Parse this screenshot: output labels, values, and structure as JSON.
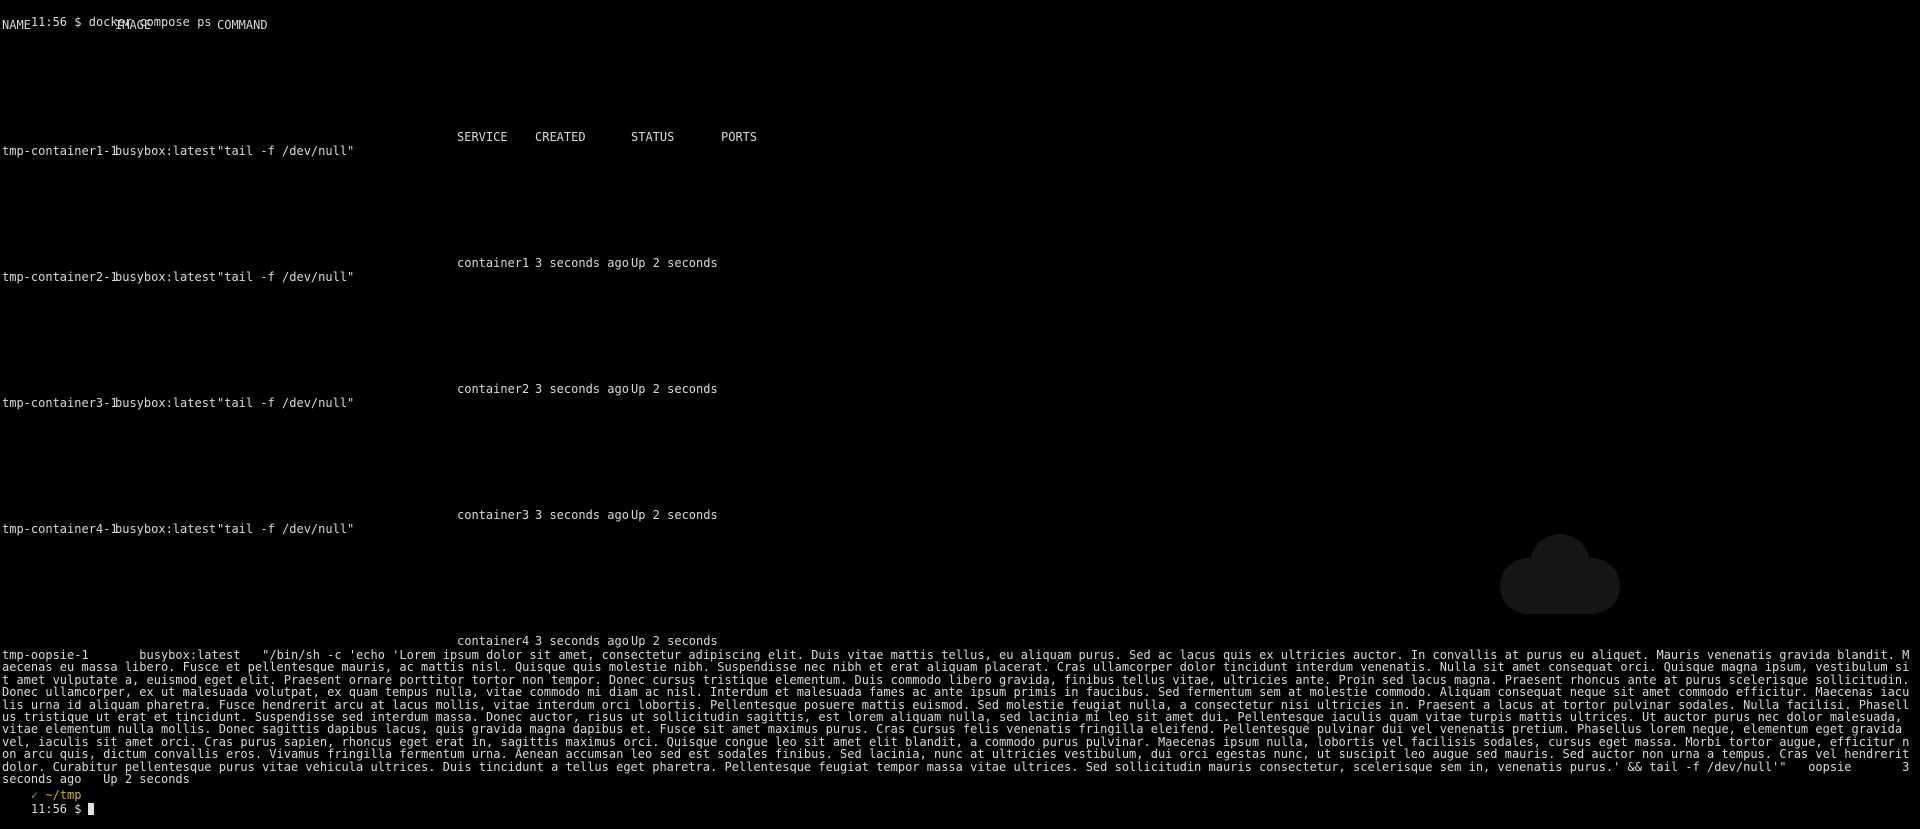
{
  "command": {
    "time": "11:56",
    "text": "$ docker compose ps"
  },
  "headers_row1": {
    "name": "NAME",
    "image": "IMAGE",
    "command": "COMMAND"
  },
  "headers_row2": {
    "service": "SERVICE",
    "created": "CREATED",
    "status": "STATUS",
    "ports": "PORTS"
  },
  "containers": [
    {
      "name": "tmp-container1-1",
      "image": "busybox:latest",
      "command": "\"tail -f /dev/null\"",
      "service": "container1",
      "created": "3 seconds ago",
      "status": "Up 2 seconds"
    },
    {
      "name": "tmp-container2-1",
      "image": "busybox:latest",
      "command": "\"tail -f /dev/null\"",
      "service": "container2",
      "created": "3 seconds ago",
      "status": "Up 2 seconds"
    },
    {
      "name": "tmp-container3-1",
      "image": "busybox:latest",
      "command": "\"tail -f /dev/null\"",
      "service": "container3",
      "created": "3 seconds ago",
      "status": "Up 2 seconds"
    },
    {
      "name": "tmp-container4-1",
      "image": "busybox:latest",
      "command": "\"tail -f /dev/null\"",
      "service": "container4",
      "created": "3 seconds ago",
      "status": "Up 2 seconds"
    }
  ],
  "oopsie": {
    "name": "tmp-oopsie-1",
    "image": "busybox:latest",
    "command_text": "\"/bin/sh -c 'echo 'Lorem ipsum dolor sit amet, consectetur adipiscing elit. Duis vitae mattis tellus, eu aliquam purus. Sed ac lacus quis ex ultricies auctor. In convallis at purus eu aliquet. Mauris venenatis gravida blandit. Maecenas eu massa libero. Fusce et pellentesque mauris, ac mattis nisl. Quisque quis molestie nibh. Suspendisse nec nibh et erat aliquam placerat. Cras ullamcorper dolor tincidunt interdum venenatis. Nulla sit amet consequat orci. Quisque magna ipsum, vestibulum sit amet vulputate a, euismod eget elit. Praesent ornare porttitor tortor non tempor. Donec cursus tristique elementum. Duis commodo libero gravida, finibus tellus vitae, ultricies ante. Proin sed lacus magna. Praesent rhoncus ante at purus scelerisque sollicitudin. Donec ullamcorper, ex ut malesuada volutpat, ex quam tempus nulla, vitae commodo mi diam ac nisl. Interdum et malesuada fames ac ante ipsum primis in faucibus. Sed fermentum sem at molestie commodo. Aliquam consequat neque sit amet commodo efficitur. Maecenas iaculis urna id aliquam pharetra. Fusce hendrerit arcu at lacus mollis, vitae interdum orci lobortis. Pellentesque posuere mattis euismod. Sed molestie feugiat nulla, a consectetur nisi ultricies in. Praesent a lacus at tortor pulvinar sodales. Nulla facilisi. Phasellus tristique ut erat et tincidunt. Suspendisse sed interdum massa. Donec auctor, risus ut sollicitudin sagittis, est lorem aliquam nulla, sed lacinia mi leo sit amet dui. Pellentesque iaculis quam vitae turpis mattis ultrices. Ut auctor purus nec dolor malesuada, vitae elementum nulla mollis. Donec sagittis dapibus lacus, quis gravida magna dapibus et. Fusce sit amet maximus purus. Cras cursus felis venenatis fringilla eleifend. Pellentesque pulvinar dui vel venenatis pretium. Phasellus lorem neque, elementum eget gravida vel, iaculis sit amet orci. Cras purus sapien, rhoncus eget erat in, sagittis maximus orci. Quisque congue leo sit amet elit blandit, a commodo purus pulvinar. Maecenas ipsum nulla, lobortis vel facilisis sodales, cursus eget massa. Morbi tortor augue, efficitur non arcu quis, dictum convallis eros. Vivamus fringilla fermentum urna. Aenean accumsan leo sed est sodales finibus. Sed lacinia, nunc at ultricies vestibulum, dui orci egestas nunc, ut suscipit leo augue sed mauris. Sed auctor non urna a tempus. Cras vel hendrerit dolor. Curabitur pellentesque purus vitae vehicula ultrices. Duis tincidunt a tellus eget pharetra. Pellentesque feugiat tempor massa vitae ultrices. Sed sollicitudin mauris consectetur, scelerisque sem in, venenatis purus.' && tail -f /dev/null'\"",
    "service": "oopsie",
    "created": "3 seconds ago",
    "status": "Up 2 seconds"
  },
  "prompt": {
    "check": "✓",
    "dir": "~/tmp",
    "time": "11:56",
    "symbol": "$"
  },
  "colors": {
    "background": "#000000",
    "foreground": "#d8d8d8",
    "prompt_dir": "#c9b400",
    "check": "#3fbf3f"
  }
}
